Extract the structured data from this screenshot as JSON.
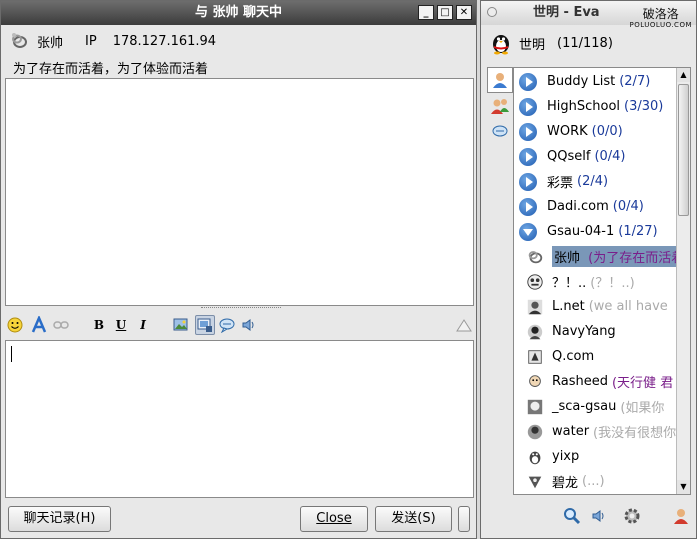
{
  "chat_window": {
    "title": "与 张帅 聊天中",
    "buddy_name": "张帅",
    "ip_label": "IP",
    "ip_value": "178.127.161.94",
    "signature": "为了存在而活着，为了体验而活着",
    "buttons": {
      "history": "聊天记录(H)",
      "close": "Close",
      "send": "发送(S)"
    },
    "format_toolbar": [
      "smiley-icon",
      "font-icon",
      "link-icon",
      "bold-icon",
      "underline-icon",
      "italic-icon",
      "image-icon",
      "screenshot-icon",
      "chat-bubble-icon",
      "speaker-icon",
      "eraser-icon"
    ],
    "format_labels": {
      "bold": "B",
      "underline": "U",
      "italic": "I"
    }
  },
  "eva_window": {
    "title": "世明 - Eva",
    "watermark_main": "破洛洛",
    "watermark_sub": "POLUOLUO.COM",
    "me_name": "世明",
    "me_counts": "(11/118)",
    "groups": [
      {
        "name": "Buddy List",
        "count": "(2/7)"
      },
      {
        "name": "HighSchool",
        "count": "(3/30)"
      },
      {
        "name": "WORK",
        "count": "(0/0)"
      },
      {
        "name": "QQself",
        "count": "(0/4)"
      },
      {
        "name": "彩票",
        "count": "(2/4)"
      },
      {
        "name": "Dadi.com",
        "count": "(0/4)"
      },
      {
        "name": "Gsau-04-1",
        "count": "(1/27)"
      }
    ],
    "buddies": [
      {
        "name": "张帅",
        "sig": "(为了存在而活着",
        "sig_color": "purple"
      },
      {
        "name": "？！..",
        "sig": "(？！..)",
        "sig_color": "grey"
      },
      {
        "name": "L.net",
        "sig": "(we all have",
        "sig_color": "grey"
      },
      {
        "name": "NavyYang",
        "sig": "",
        "sig_color": "grey"
      },
      {
        "name": "Q.com",
        "sig": "",
        "sig_color": "grey"
      },
      {
        "name": "Rasheed",
        "sig": "(天行健 君",
        "sig_color": "purple"
      },
      {
        "name": "_sca-gsau",
        "sig": "(如果你",
        "sig_color": "grey"
      },
      {
        "name": "water",
        "sig": "(我没有很想你",
        "sig_color": "grey"
      },
      {
        "name": "yixp",
        "sig": "",
        "sig_color": "grey"
      },
      {
        "name": "碧龙",
        "sig": "(...)",
        "sig_color": "grey"
      }
    ]
  }
}
